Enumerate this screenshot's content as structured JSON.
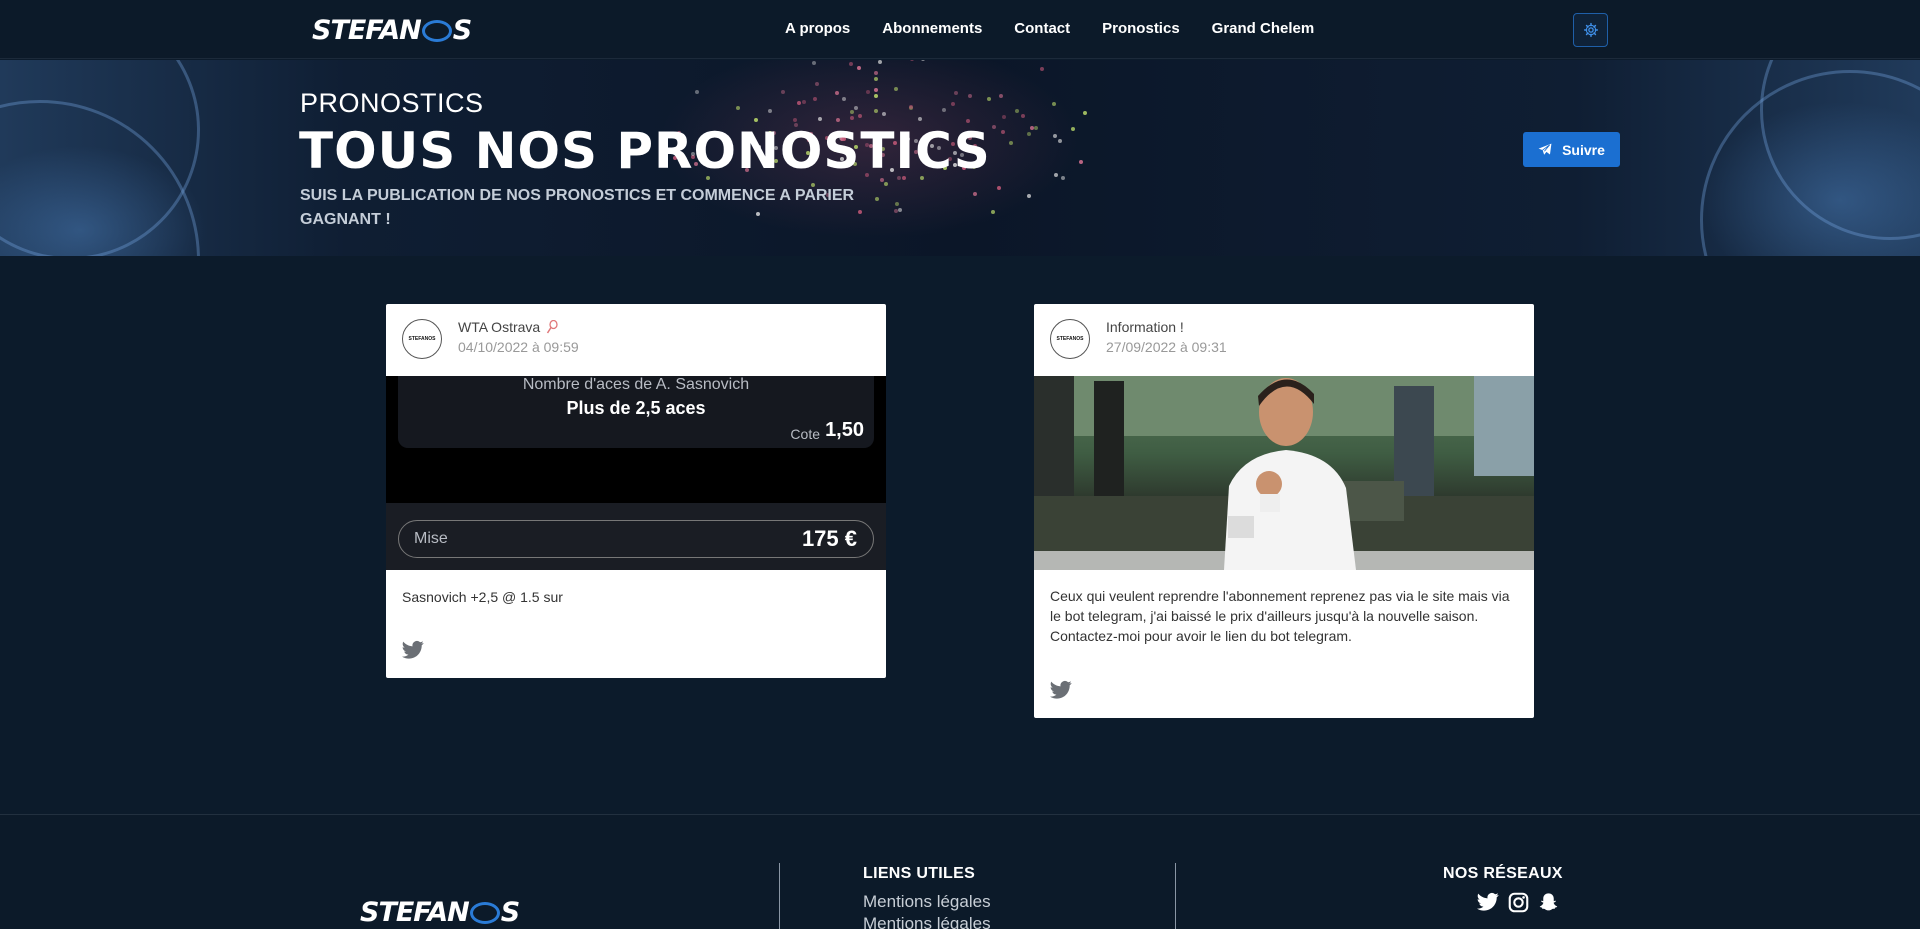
{
  "brand": {
    "logo_left": "STEFAN",
    "logo_right": "S"
  },
  "nav": {
    "links": [
      "A propos",
      "Abonnements",
      "Contact",
      "Pronostics",
      "Grand Chelem"
    ]
  },
  "hero": {
    "section": "PRONOSTICS",
    "title": "TOUS NOS PRONOSTICS",
    "description": "SUIS LA PUBLICATION DE NOS PRONOSTICS ET COMMENCE A PARIER GAGNANT !",
    "follow_label": "Suivre"
  },
  "cards": [
    {
      "avatar_text": "STEFANOS",
      "title": "WTA Ostrava",
      "date": "04/10/2022 à 09:59",
      "bet": {
        "market": "Nombre d'aces de A. Sasnovich",
        "selection": "Plus de 2,5 aces",
        "cote_label": "Cote",
        "cote_value": "1,50",
        "mise_label": "Mise",
        "mise_value": "175 €"
      },
      "text": "Sasnovich +2,5 @ 1.5 sur"
    },
    {
      "avatar_text": "STEFANOS",
      "title": "Information !",
      "date": "27/09/2022 à 09:31",
      "text": "Ceux qui veulent reprendre l'abonnement reprenez pas via le site mais via le bot telegram, j'ai baissé le prix d'ailleurs jusqu'à la nouvelle saison. Contactez-moi pour avoir le lien du bot telegram."
    }
  ],
  "footer": {
    "useful_links_title": "LIENS UTILES",
    "links": [
      "Mentions légales",
      "Mentions légales"
    ],
    "social_title": "NOS RÉSEAUX",
    "social_icons": [
      "twitter-icon",
      "instagram-icon",
      "snapchat-icon"
    ]
  },
  "colors": {
    "accent": "#1b6fd1",
    "background": "#0c1b2b"
  }
}
